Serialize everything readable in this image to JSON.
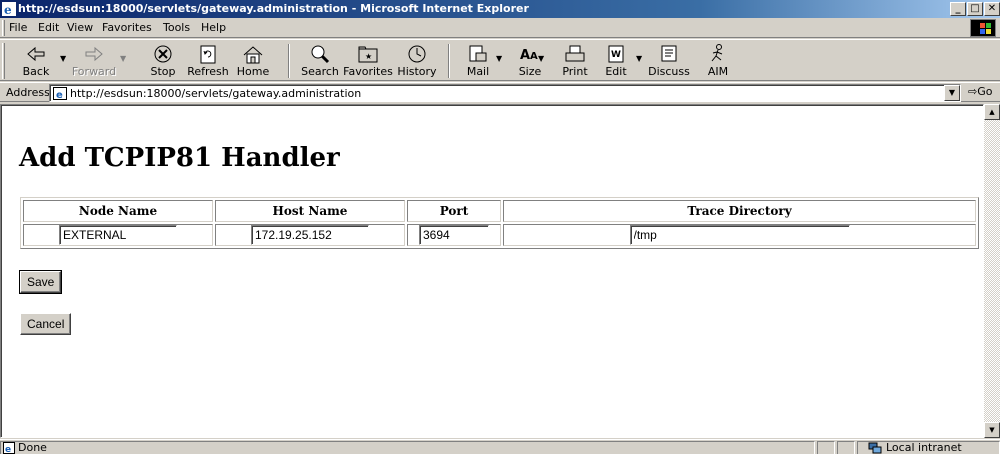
{
  "window": {
    "title": "http://esdsun:18000/servlets/gateway.administration - Microsoft Internet Explorer"
  },
  "menu": [
    "File",
    "Edit",
    "View",
    "Favorites",
    "Tools",
    "Help"
  ],
  "toolbar": {
    "back": "Back",
    "forward": "Forward",
    "stop": "Stop",
    "refresh": "Refresh",
    "home": "Home",
    "search": "Search",
    "favorites": "Favorites",
    "history": "History",
    "mail": "Mail",
    "size": "Size",
    "print": "Print",
    "edit": "Edit",
    "discuss": "Discuss",
    "aim": "AIM"
  },
  "address": {
    "label": "Address",
    "url": "http://esdsun:18000/servlets/gateway.administration",
    "go": "Go"
  },
  "page": {
    "heading": "Add TCPIP81 Handler",
    "columns": [
      "Node Name",
      "Host Name",
      "Port",
      "Trace Directory"
    ],
    "values": {
      "node_name": "EXTERNAL",
      "host_name": "172.19.25.152",
      "port": "3694",
      "trace_directory": "/tmp"
    },
    "save": "Save",
    "cancel": "Cancel"
  },
  "status": {
    "text": "Done",
    "zone": "Local intranet"
  }
}
